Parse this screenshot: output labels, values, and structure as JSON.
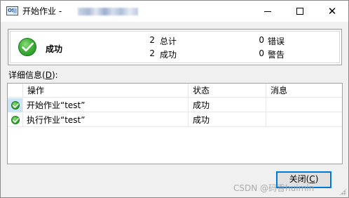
{
  "window": {
    "icon_text": "OS",
    "title_prefix": "开始作业 -",
    "minimize_glyph": "",
    "close_glyph": "✕"
  },
  "summary": {
    "status": "成功",
    "icon": "success-check-icon",
    "stats": [
      {
        "count": "2",
        "label": "总计"
      },
      {
        "count": "0",
        "label": "错误"
      },
      {
        "count": "2",
        "label": "成功"
      },
      {
        "count": "0",
        "label": "警告"
      }
    ]
  },
  "details": {
    "label": "详细信息(D):",
    "label_prefix": "详细信息(",
    "label_key": "D",
    "label_suffix": "):",
    "columns": [
      "操作",
      "状态",
      "消息"
    ],
    "rows": [
      {
        "action": "开始作业“test”",
        "status": "成功",
        "message": "",
        "icon": "success-check-icon"
      },
      {
        "action": "执行作业“test”",
        "status": "成功",
        "message": "",
        "icon": "success-check-icon"
      }
    ]
  },
  "close_button": {
    "prefix": "关闭(",
    "key": "C",
    "suffix": ")"
  },
  "watermark": "CSDN @码香huimin",
  "colors": {
    "accent": "#0078d7",
    "success": "#3fb13a",
    "window_bg": "#f0f0f0"
  }
}
